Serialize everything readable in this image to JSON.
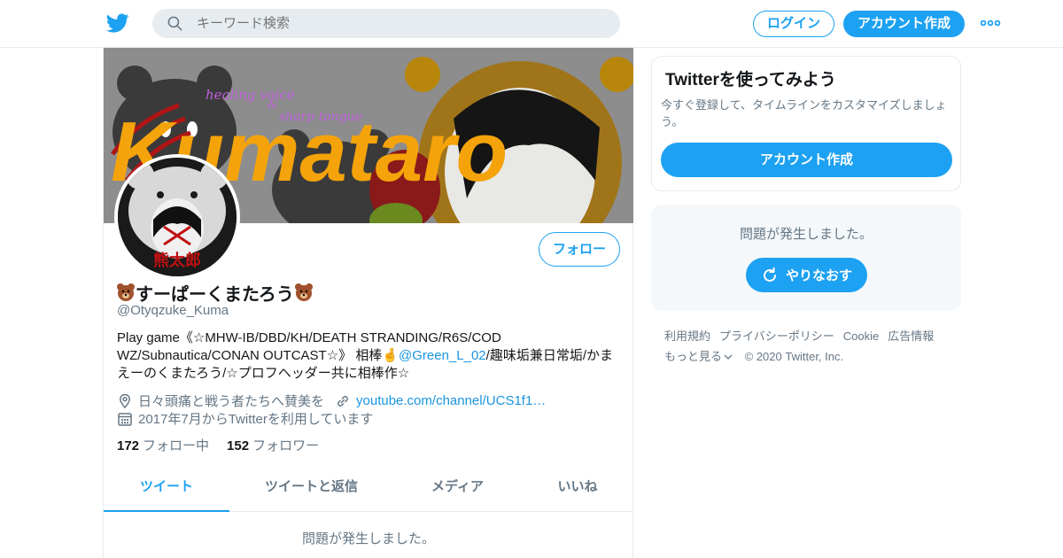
{
  "header": {
    "search_placeholder": "キーワード検索",
    "login_label": "ログイン",
    "signup_label": "アカウント作成"
  },
  "banner": {
    "text_brand": "Kumataro",
    "text_healing": "healing voice",
    "text_amp": "&",
    "text_sharp": "sharp tongue"
  },
  "profile": {
    "avatar_text": "熊太郎",
    "follow_label": "フォロー",
    "display_name": "すーぱーくまたろう",
    "handle": "@Otyqzuke_Kuma",
    "bio_part1": "Play game《☆MHW-IB/DBD/KH/DEATH STRANDING/R6S/COD WZ/Subnautica/CONAN OUTCAST☆》 相棒🤞",
    "bio_mention": "@Green_L_02",
    "bio_part2": "/趣味垢兼日常垢/かまえーのくまたろう/☆プロフヘッダー共に相棒作☆",
    "location": "日々頭痛と戦う者たちへ賛美を",
    "website": "youtube.com/channel/UCS1f1…",
    "joined": "2017年7月からTwitterを利用しています",
    "following_count": "172",
    "following_label": "フォロー中",
    "followers_count": "152",
    "followers_label": "フォロワー"
  },
  "tabs": [
    {
      "label": "ツイート"
    },
    {
      "label": "ツイートと返信"
    },
    {
      "label": "メディア"
    },
    {
      "label": "いいね"
    }
  ],
  "main_error": "問題が発生しました。",
  "sidebar": {
    "card_title": "Twitterを使ってみよう",
    "card_text": "今すぐ登録して、タイムラインをカスタマイズしましょう。",
    "card_button": "アカウント作成",
    "error_text": "問題が発生しました。",
    "retry_label": "やりなおす"
  },
  "footer": {
    "links": [
      "利用規約",
      "プライバシーポリシー",
      "Cookie",
      "広告情報"
    ],
    "more_label": "もっと見る",
    "copyright": "© 2020 Twitter, Inc."
  },
  "colors": {
    "accent": "#1da1f2",
    "text_secondary": "#657786",
    "border": "#e6ecf0"
  }
}
